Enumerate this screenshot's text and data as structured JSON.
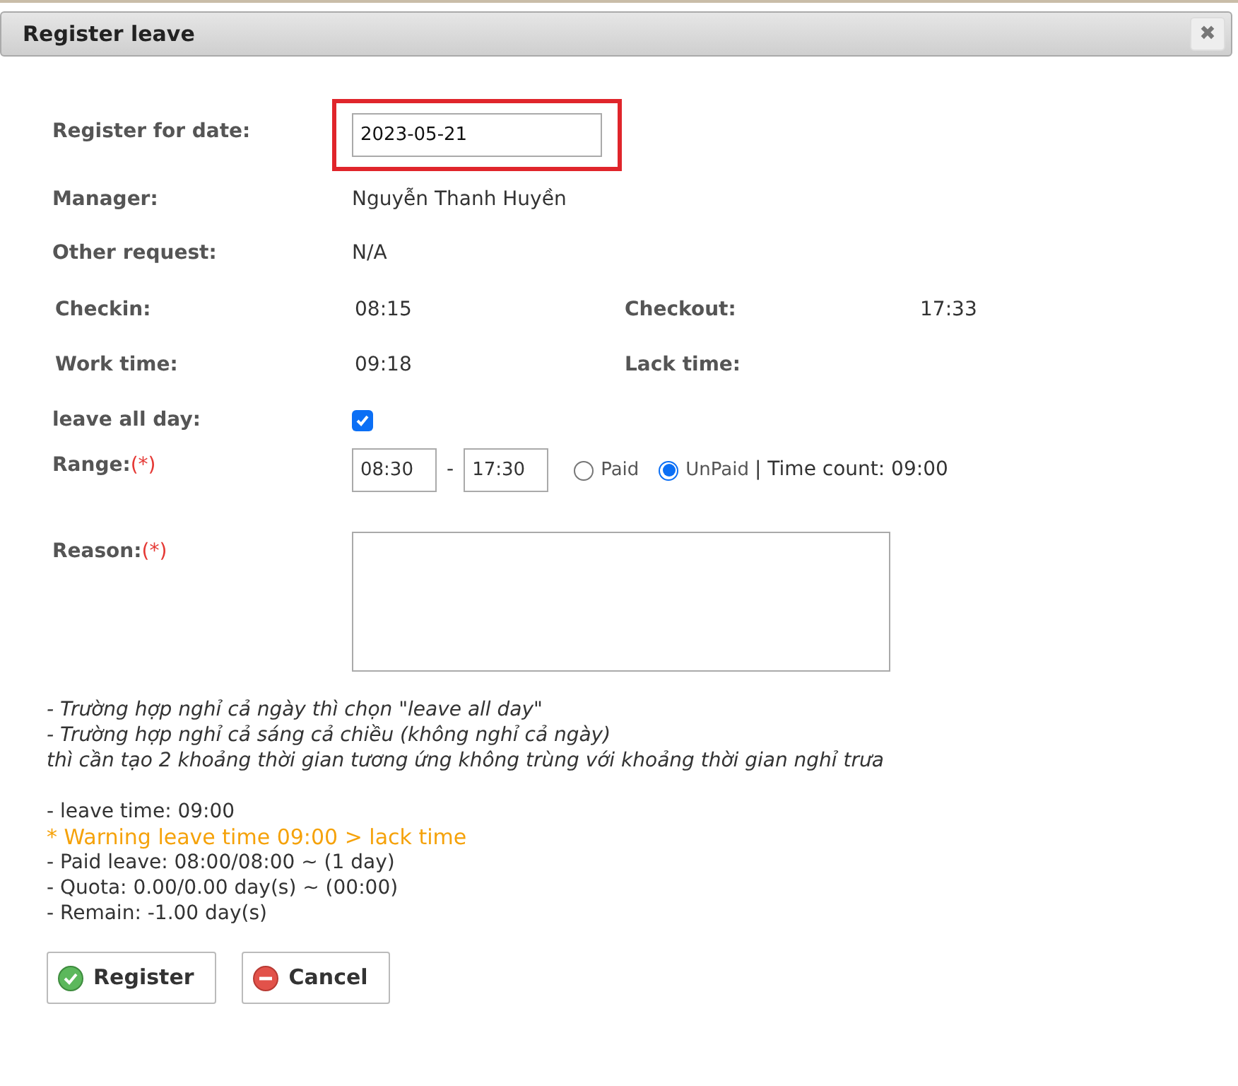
{
  "dialog": {
    "title": "Register leave",
    "close": "✖"
  },
  "date": {
    "label": "Register for date:",
    "value": "2023-05-21",
    "highlighted": true
  },
  "info": [
    {
      "label": "Manager:",
      "value": "Nguyễn Thanh Huyền"
    },
    {
      "label": "Other request:",
      "value": "N/A"
    }
  ],
  "times": [
    {
      "label": "Checkin:",
      "value": "08:15",
      "label2": "Checkout:",
      "value2": "17:33"
    },
    {
      "label": "Work time:",
      "value": "09:18",
      "label2": "Lack time:"
    }
  ],
  "leave_all_day": {
    "label": "leave all day:",
    "checked": true
  },
  "range": {
    "label": "Range:",
    "required": "(*)",
    "from": "08:30",
    "separator": "-",
    "to": "17:30",
    "options": [
      {
        "label": "Paid",
        "selected": false
      },
      {
        "label": "UnPaid",
        "selected": true
      }
    ],
    "time_count": "| Time count: 09:00"
  },
  "reason": {
    "label": "Reason:",
    "required": "(*)"
  },
  "notes": [
    "- Trường hợp nghỉ cả ngày thì chọn \"leave all day\"",
    "- Trường hợp nghỉ cả sáng cả chiều (không nghỉ cả ngày)",
    "thì cần tạo 2 khoảng thời gian tương ứng không trùng với khoảng thời gian nghỉ trưa"
  ],
  "summary": [
    {
      "kind": "normal",
      "text": "- leave time: 09:00"
    },
    {
      "kind": "warning",
      "text": "* Warning leave time 09:00 > lack time"
    },
    {
      "kind": "normal",
      "text": "- Paid leave: 08:00/08:00 ~ (1 day)"
    },
    {
      "kind": "normal",
      "text": "- Quota: 0.00/0.00 day(s) ~ (00:00)"
    },
    {
      "kind": "normal",
      "text": "- Remain: -1.00 day(s)"
    }
  ],
  "buttons": [
    {
      "kind": "ok",
      "label": "Register"
    },
    {
      "kind": "cancel",
      "label": "Cancel"
    }
  ]
}
